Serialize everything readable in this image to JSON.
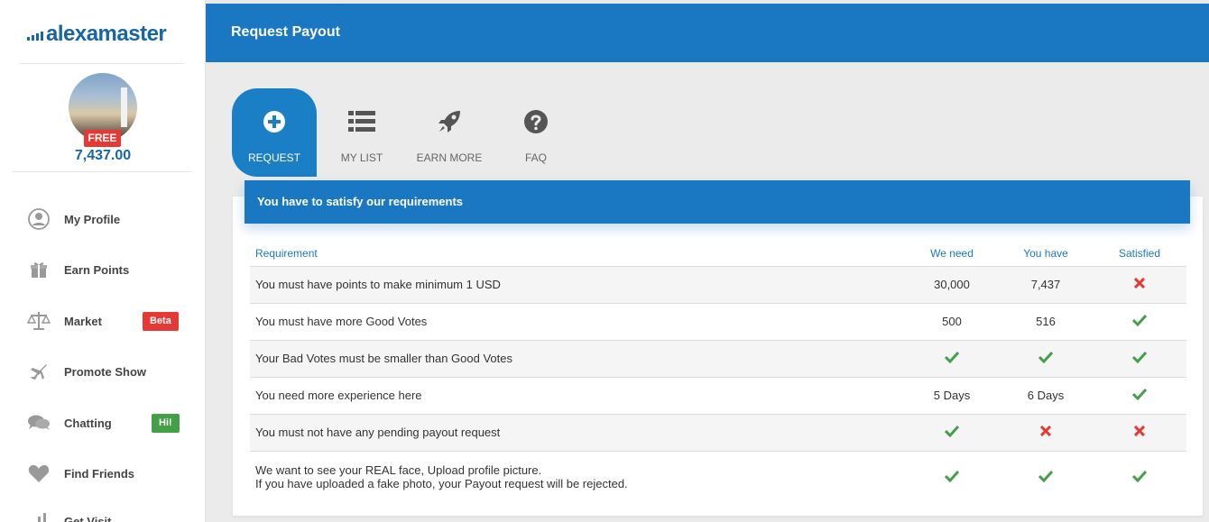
{
  "brand": {
    "logo_text": "alexamaster",
    "color": "#1565a7"
  },
  "user": {
    "badge": "FREE",
    "points": "7,437.00"
  },
  "sidebar": {
    "items": [
      {
        "label": "My Profile",
        "icon": "user-icon"
      },
      {
        "label": "Earn Points",
        "icon": "gift-icon"
      },
      {
        "label": "Market",
        "icon": "scale-icon",
        "badge": "Beta",
        "badge_color": "#e53935"
      },
      {
        "label": "Promote Show",
        "icon": "plane-icon"
      },
      {
        "label": "Chatting",
        "icon": "chat-icon",
        "badge": "Hi!",
        "badge_color": "#43a047"
      },
      {
        "label": "Find Friends",
        "icon": "heart-icon"
      },
      {
        "label": "Get Visit",
        "icon": "chart-icon"
      }
    ]
  },
  "header": {
    "title": "Request Payout",
    "color": "#1a78c2"
  },
  "tabs": [
    {
      "label": "REQUEST",
      "icon": "plus-circle-icon",
      "active": true
    },
    {
      "label": "MY LIST",
      "icon": "list-icon",
      "active": false
    },
    {
      "label": "EARN MORE",
      "icon": "rocket-icon",
      "active": false
    },
    {
      "label": "FAQ",
      "icon": "question-circle-icon",
      "active": false
    }
  ],
  "panel": {
    "banner": "You have to satisfy our requirements",
    "columns": [
      "Requirement",
      "We need",
      "You have",
      "Satisfied"
    ],
    "rows": [
      {
        "requirement": "You must have points to make minimum 1 USD",
        "need": "30,000",
        "have": "7,437",
        "satisfied": "cross"
      },
      {
        "requirement": "You must have more Good Votes",
        "need": "500",
        "have": "516",
        "satisfied": "check"
      },
      {
        "requirement": "Your Bad Votes must be smaller than Good Votes",
        "need": "check",
        "have": "check",
        "satisfied": "check"
      },
      {
        "requirement": "You need more experience here",
        "need": "5 Days",
        "have": "6 Days",
        "satisfied": "check"
      },
      {
        "requirement": "You must not have any pending payout request",
        "need": "check",
        "have": "cross",
        "satisfied": "cross"
      },
      {
        "requirement": "We want to see your REAL face, Upload profile picture.",
        "requirement_line2": "If you have uploaded a fake photo, your Payout request will be rejected.",
        "need": "check",
        "have": "check",
        "satisfied": "check"
      }
    ]
  },
  "colors": {
    "check": "#43a047",
    "cross": "#e53935",
    "accent": "#1a78c2"
  }
}
